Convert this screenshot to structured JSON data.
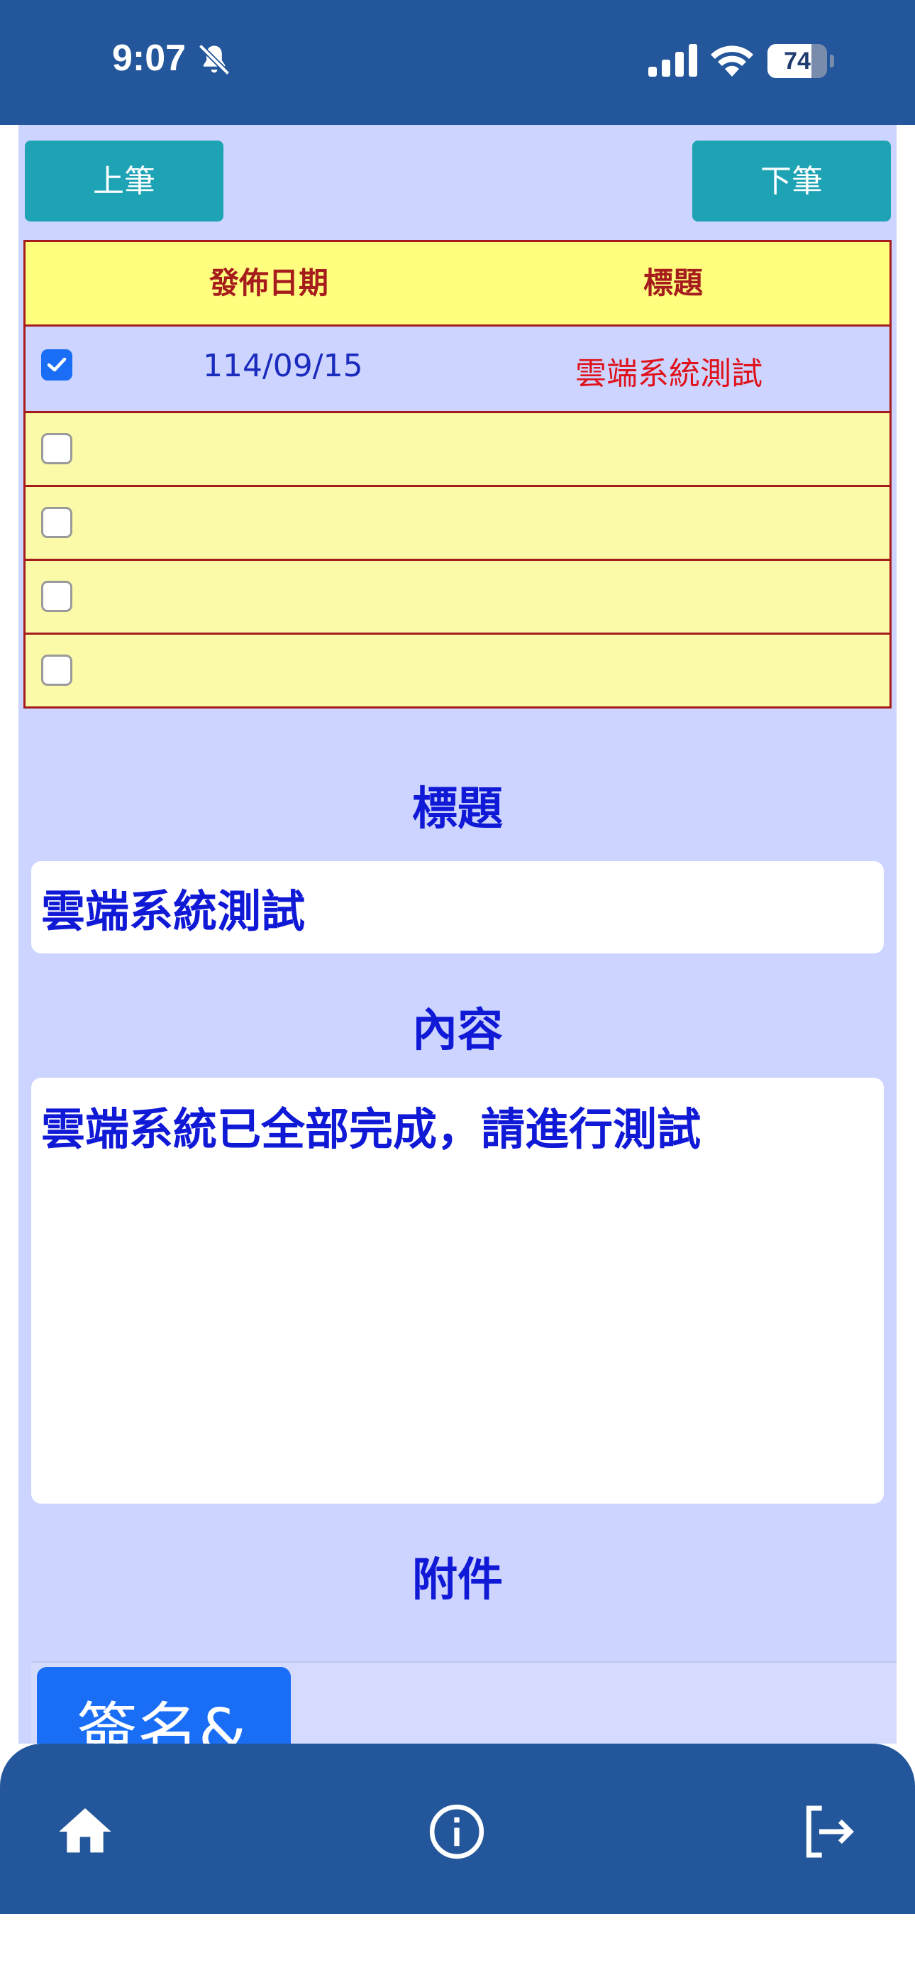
{
  "status_bar": {
    "time": "9:07",
    "battery_level": "74",
    "battery_fraction": 0.74,
    "icons": [
      "bell-slash-icon",
      "signal-icon",
      "wifi-icon",
      "battery-icon"
    ]
  },
  "toolbar": {
    "prev_label": "上筆",
    "next_label": "下筆"
  },
  "table": {
    "headers": {
      "date": "發佈日期",
      "title": "標題"
    },
    "rows": [
      {
        "checked": true,
        "date": "114/09/15",
        "title": "雲端系統測試"
      },
      {
        "checked": false,
        "date": "",
        "title": ""
      },
      {
        "checked": false,
        "date": "",
        "title": ""
      },
      {
        "checked": false,
        "date": "",
        "title": ""
      },
      {
        "checked": false,
        "date": "",
        "title": ""
      }
    ]
  },
  "detail": {
    "title_label": "標題",
    "title_value": "雲端系統測試",
    "content_label": "內容",
    "content_value": "雲端系統已全部完成，請進行測試",
    "attachment_label": "附件",
    "sign_button_label": "簽名&"
  },
  "bottom_nav": {
    "items": [
      "home-icon",
      "info-icon",
      "logout-icon"
    ]
  },
  "colors": {
    "header_bar": "#23569b",
    "page_bg": "#ccd4ff",
    "nav_button": "#1ea3b5",
    "table_header_bg": "#fffe7e",
    "table_border": "#a61c1c",
    "empty_row_bg": "#fbfaa8",
    "label_blue": "#1019d6",
    "title_red": "#e0111a",
    "sign_button": "#1a6ef5"
  }
}
